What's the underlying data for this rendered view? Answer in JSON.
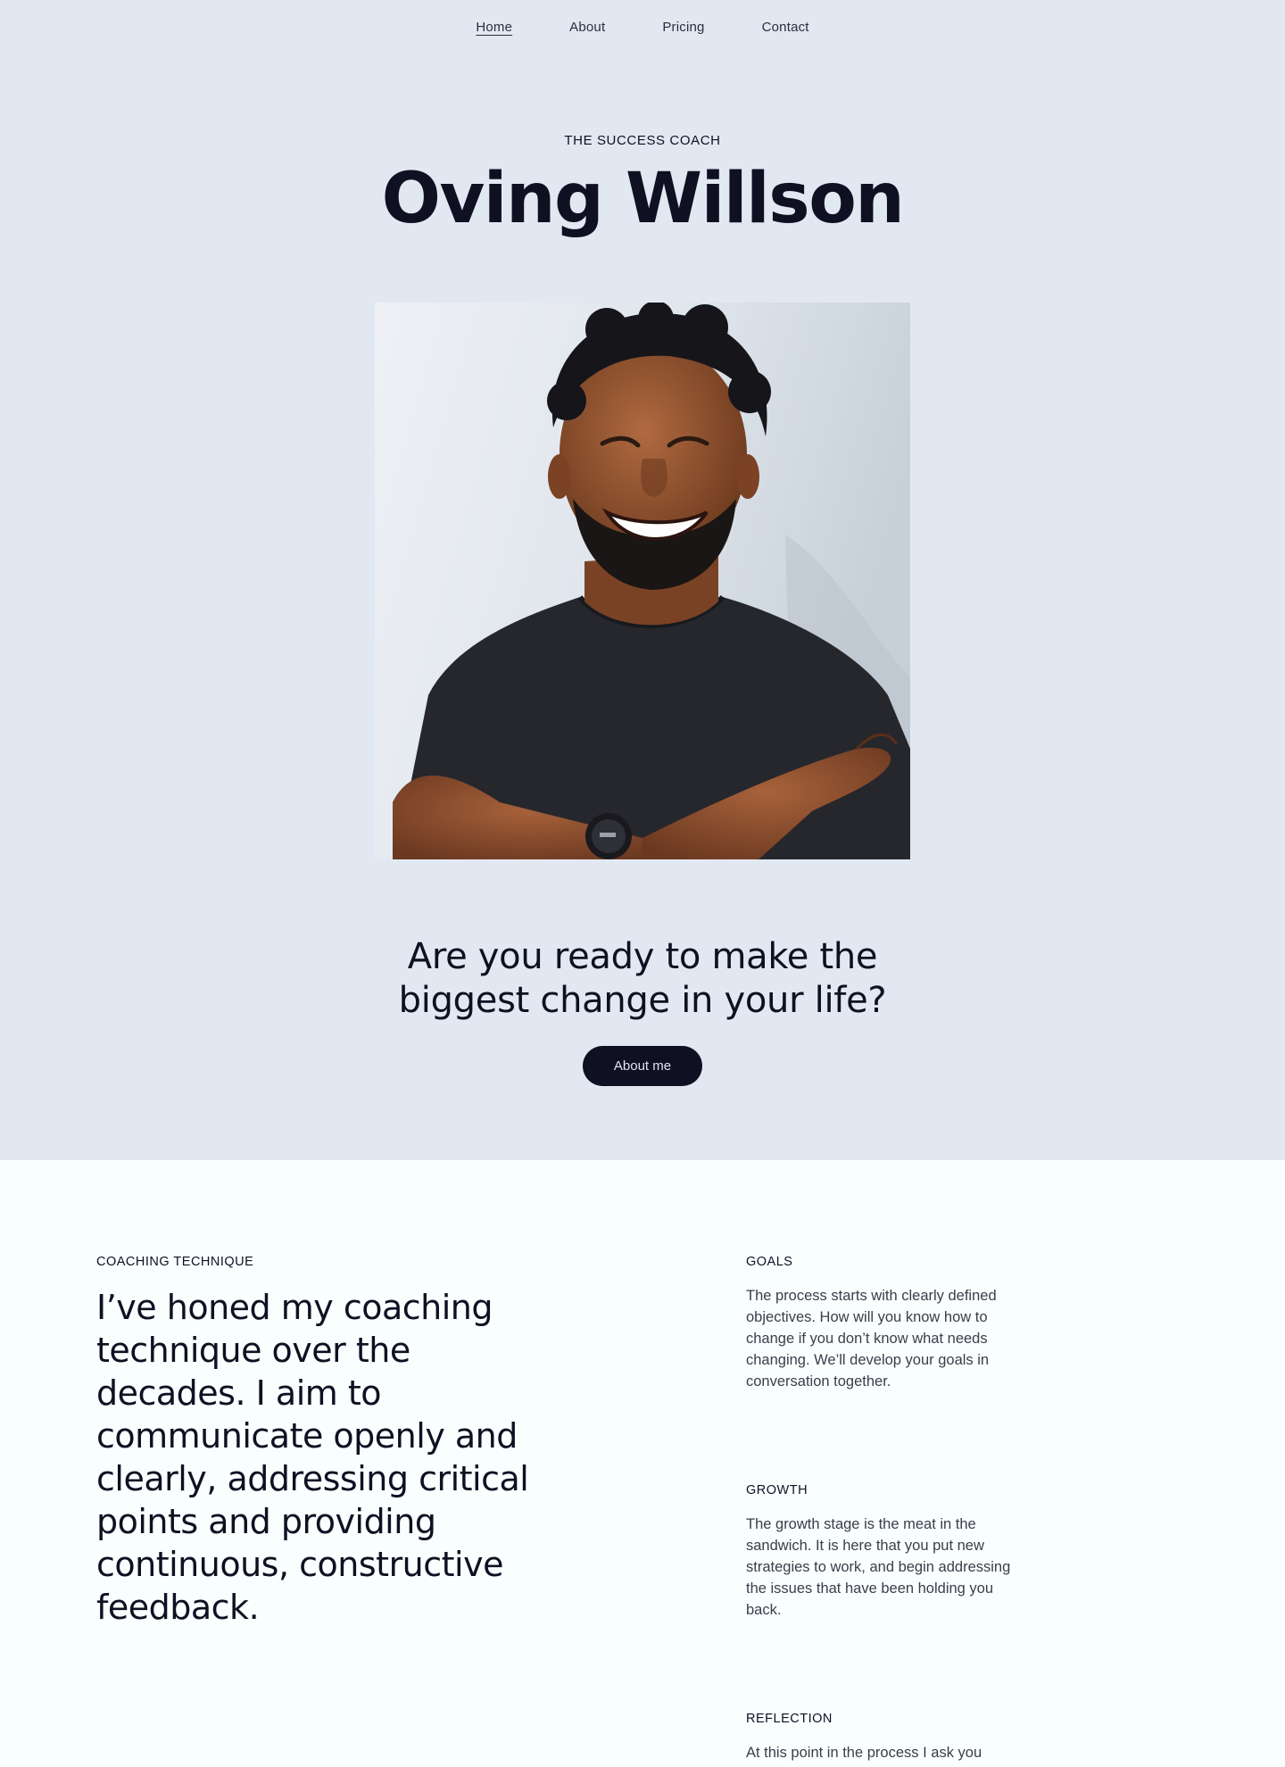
{
  "nav": {
    "items": [
      {
        "label": "Home",
        "active": true
      },
      {
        "label": "About",
        "active": false
      },
      {
        "label": "Pricing",
        "active": false
      },
      {
        "label": "Contact",
        "active": false
      }
    ]
  },
  "hero": {
    "eyebrow": "THE SUCCESS COACH",
    "title": "Oving Willson",
    "tagline_line1": "Are you ready to make the",
    "tagline_line2": "biggest change in your life?",
    "button_label": "About me"
  },
  "technique": {
    "eyebrow": "COACHING TECHNIQUE",
    "statement": "I’ve honed my coaching technique over the decades. I aim to communicate openly and clearly, addressing critical points and providing continuous, constructive feedback."
  },
  "steps": [
    {
      "title": "GOALS",
      "body": "The process starts with clearly defined objectives. How will you know how to change if you don’t know what needs changing. We’ll develop your goals in conversation together."
    },
    {
      "title": "GROWTH",
      "body": "The growth stage is the meat in the sandwich. It is here that you put new strategies to work, and begin addressing the issues that have been holding you back."
    },
    {
      "title": "REFLECTION",
      "body": "At this point in the process I ask you"
    }
  ],
  "colors": {
    "hero_bg": "#e2e8f1",
    "section_bg": "#f9fffe",
    "ink": "#0f1022",
    "button_bg": "#0f1022"
  }
}
